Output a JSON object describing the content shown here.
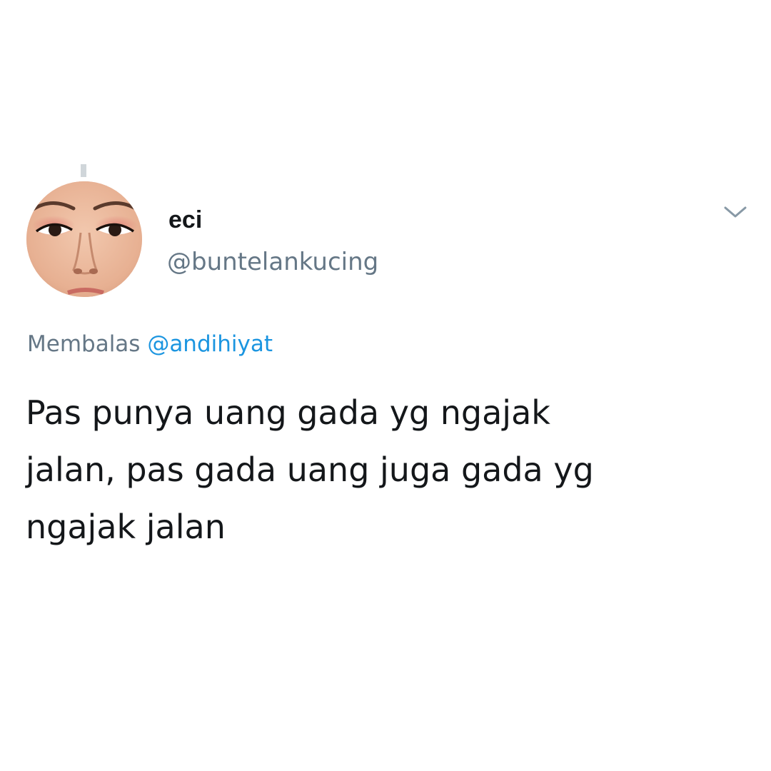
{
  "tweet": {
    "author": {
      "display_name": "eci",
      "handle": "@buntelankucing"
    },
    "reply": {
      "prefix": "Membalas",
      "mention": "@andihiyat"
    },
    "text_lines": [
      "Pas punya uang gada yg ngajak",
      "jalan, pas gada uang juga gada yg",
      "ngajak jalan"
    ],
    "menu_icon": "chevron-down-icon"
  },
  "colors": {
    "text_primary": "#14171a",
    "text_secondary": "#657786",
    "link": "#1b95e0",
    "background": "#ffffff"
  }
}
